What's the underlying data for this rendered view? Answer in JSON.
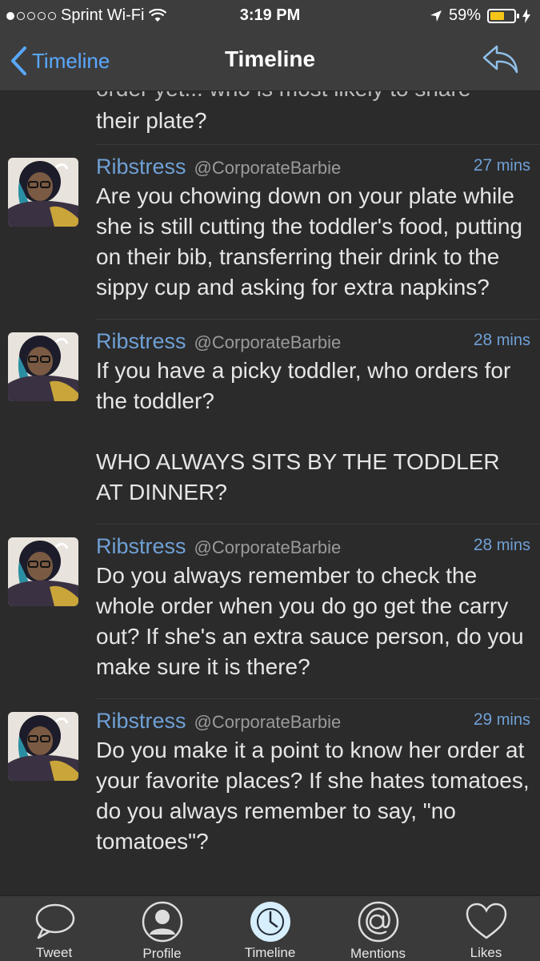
{
  "status_bar": {
    "carrier": "Sprint Wi-Fi",
    "time": "3:19 PM",
    "battery_percent": "59%",
    "battery_level": 0.59
  },
  "nav": {
    "back_label": "Timeline",
    "title": "Timeline"
  },
  "feed": {
    "partial_top_cut": "order yet... who is most likely to share",
    "partial_tail": "their plate?",
    "tweets": [
      {
        "name": "Ribstress",
        "handle": "@CorporateBarbie",
        "time_num": "27",
        "time_unit": "mins",
        "text": "Are you chowing down on your plate while she is still cutting the toddler's food, putting on their bib, transferring their drink to the sippy cup and asking for extra napkins?"
      },
      {
        "name": "Ribstress",
        "handle": "@CorporateBarbie",
        "time_num": "28",
        "time_unit": "mins",
        "text": "If you have a picky toddler, who orders for the toddler?\n\nWHO ALWAYS SITS BY THE TODDLER AT DINNER?"
      },
      {
        "name": "Ribstress",
        "handle": "@CorporateBarbie",
        "time_num": "28",
        "time_unit": "mins",
        "text": "Do you always remember to check the whole order when you do go get the carry out? If she's an extra sauce person, do you make sure it is there?"
      },
      {
        "name": "Ribstress",
        "handle": "@CorporateBarbie",
        "time_num": "29",
        "time_unit": "mins",
        "text": "Do you make it a point to know her order at your favorite places? If she hates tomatoes, do you always remember to say, \"no tomatoes\"?"
      }
    ]
  },
  "tabs": [
    {
      "label": "Tweet",
      "icon": "speech-bubble-icon"
    },
    {
      "label": "Profile",
      "icon": "person-icon"
    },
    {
      "label": "Timeline",
      "icon": "clock-icon",
      "active": true
    },
    {
      "label": "Mentions",
      "icon": "at-icon"
    },
    {
      "label": "Likes",
      "icon": "heart-icon"
    }
  ],
  "colors": {
    "accent": "#5aa8ff",
    "name": "#6fa0d6",
    "battery": "#f5c518",
    "background": "#2b2b2b"
  }
}
